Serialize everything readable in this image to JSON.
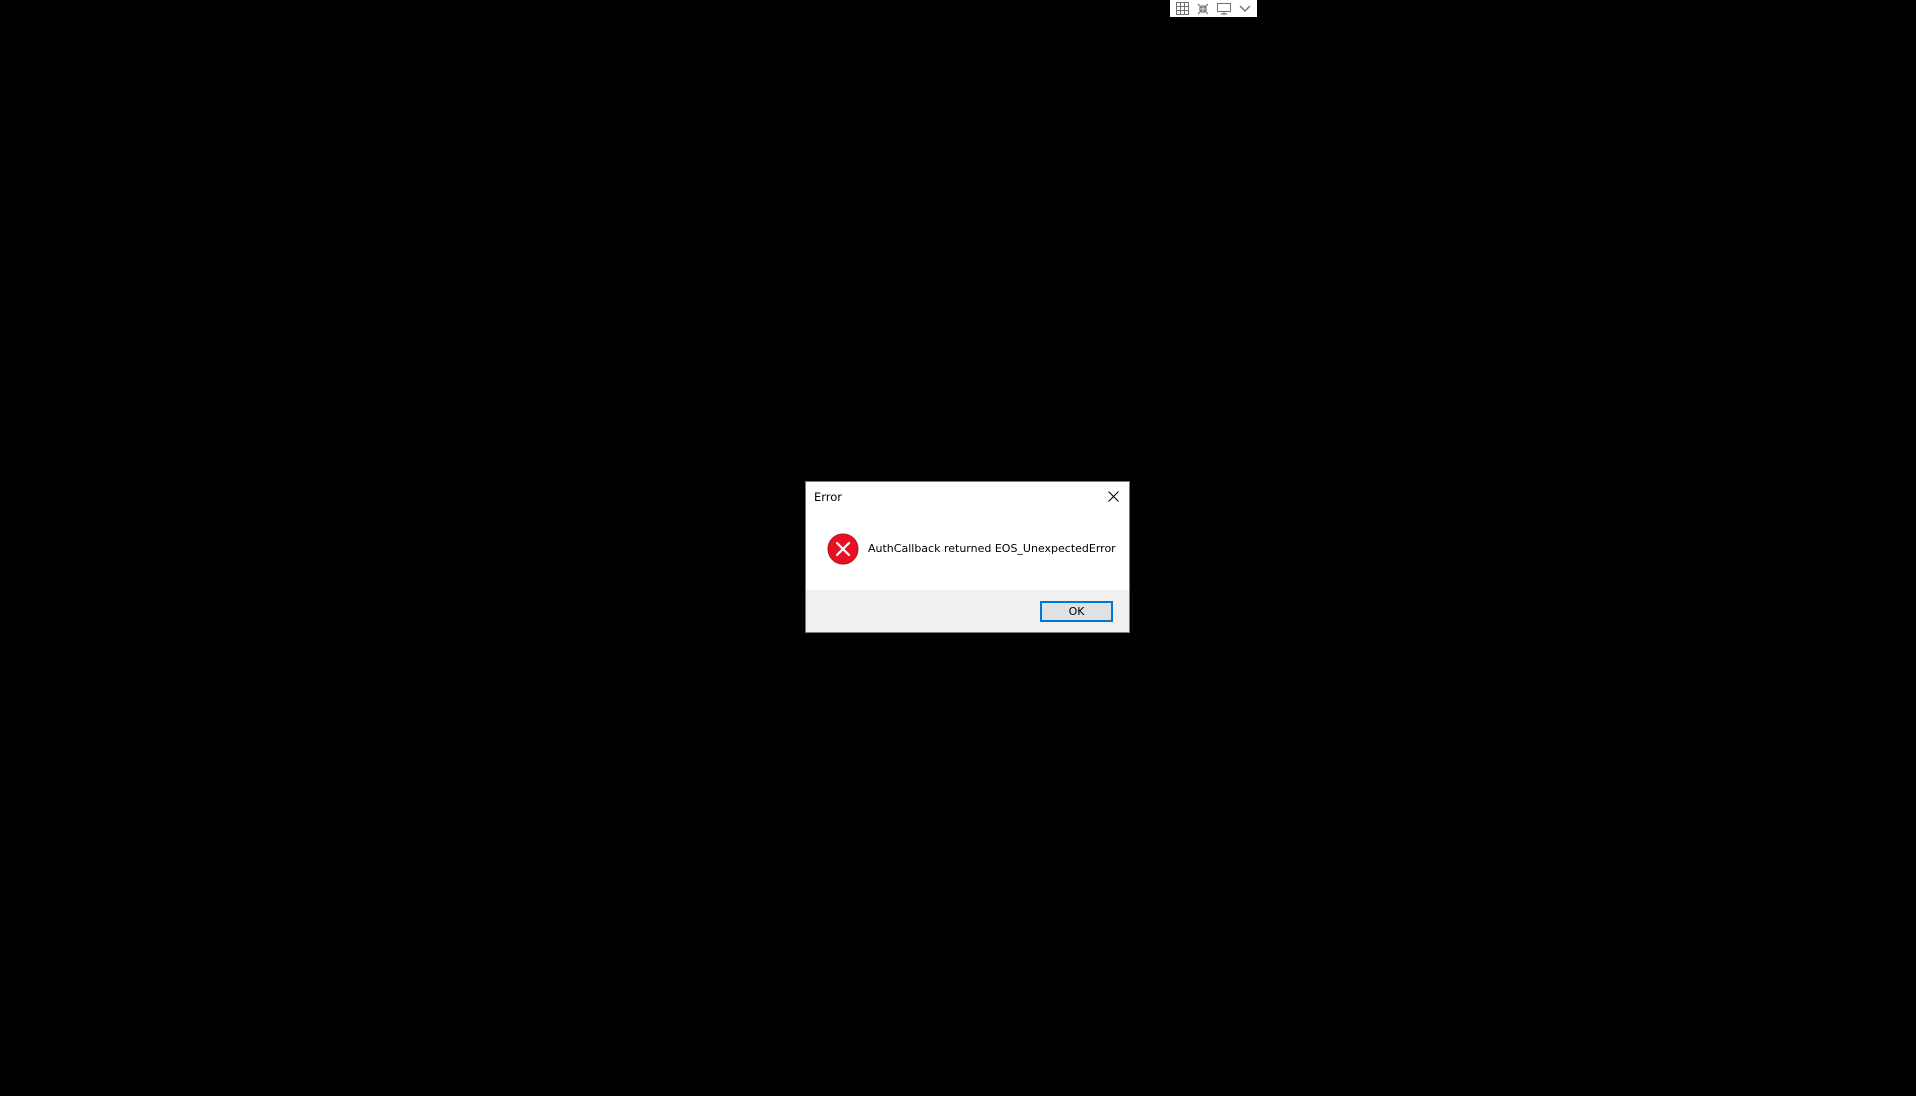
{
  "connection_bar": {
    "icons": [
      "grid-icon",
      "collapse-icon",
      "monitor-icon",
      "chevron-down-icon"
    ]
  },
  "dialog": {
    "title": "Error",
    "close_icon": "close-icon",
    "status_icon": "error-icon",
    "message": "AuthCallback returned EOS_UnexpectedError",
    "ok_label": "OK"
  },
  "colors": {
    "background": "#000000",
    "dialog_bg": "#ffffff",
    "footer_bg": "#f0f0f0",
    "button_focus_border": "#0078d7",
    "error_red": "#e81123"
  }
}
